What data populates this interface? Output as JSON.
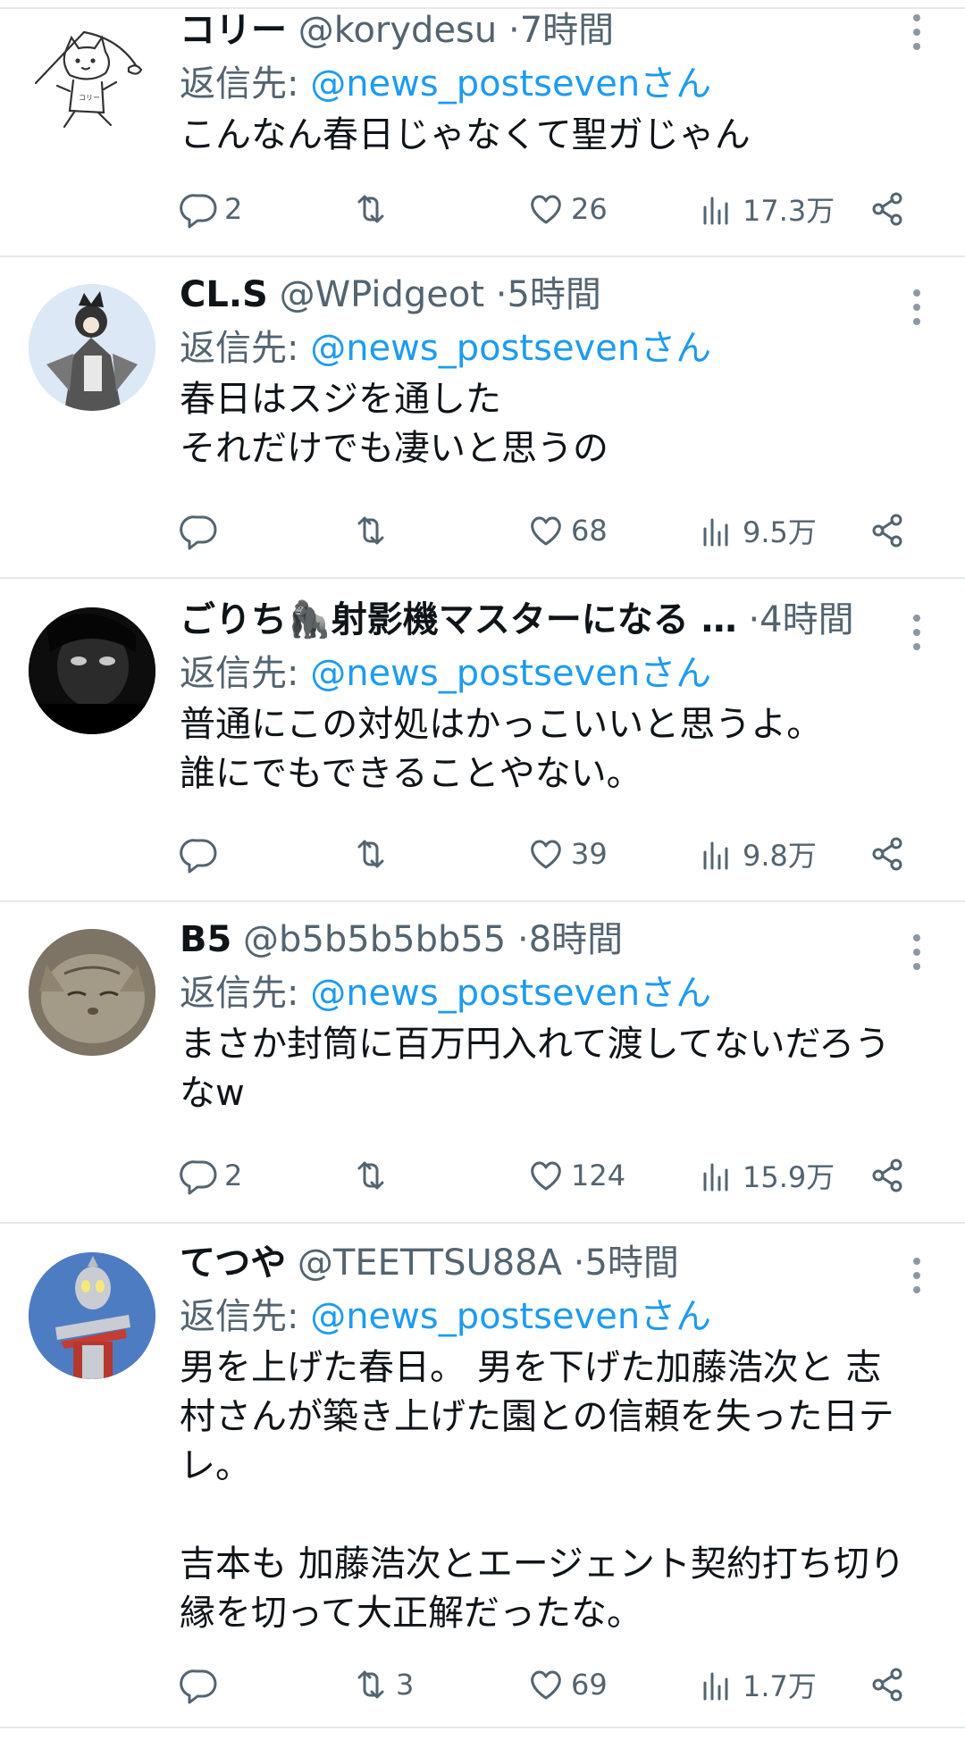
{
  "reply_prefix": "返信先: ",
  "tweets": [
    {
      "name": "コリー",
      "handle": "@korydesu",
      "dot": "·",
      "time": "7時間",
      "reply_to": "@news_postsevenさん",
      "text": "こんなん春日じゃなくて聖ガじゃん",
      "replies": "2",
      "retweets": "",
      "likes": "26",
      "views": "17.3万",
      "avatar_icon": "cat-drawing-icon"
    },
    {
      "name": "CL.S",
      "handle": "@WPidgeot",
      "dot": "·",
      "time": "5時間",
      "reply_to": "@news_postsevenさん",
      "text": "春日はスジを通した\nそれだけでも凄いと思うの",
      "replies": "",
      "retweets": "",
      "likes": "68",
      "views": "9.5万",
      "avatar_icon": "anime-character-icon"
    },
    {
      "name": "ごりち🦍射影機マスターになる …",
      "handle": "",
      "dot": "·",
      "time": "4時間",
      "reply_to": "@news_postsevenさん",
      "text": "普通にこの対処はかっこいいと思うよ。\n誰にでもできることやない。",
      "replies": "",
      "retweets": "",
      "likes": "39",
      "views": "9.8万",
      "avatar_icon": "dark-face-icon"
    },
    {
      "name": "B5",
      "handle": "@b5b5b5bb55",
      "dot": "·",
      "time": "8時間",
      "reply_to": "@news_postsevenさん",
      "text": "まさか封筒に百万円入れて渡してないだろう\nなw",
      "replies": "2",
      "retweets": "",
      "likes": "124",
      "views": "15.9万",
      "avatar_icon": "cat-photo-icon"
    },
    {
      "name": "てつや",
      "handle": "@TEETTSU88A",
      "dot": "·",
      "time": "5時間",
      "reply_to": "@news_postsevenさん",
      "text": "男を上げた春日。 男を下げた加藤浩次と 志\n村さんが築き上げた園との信頼を失った日テ\nレ。\n\n吉本も 加藤浩次とエージェント契約打ち切り\n縁を切って大正解だったな。",
      "replies": "",
      "retweets": "3",
      "likes": "69",
      "views": "1.7万",
      "avatar_icon": "ultraman-icon"
    }
  ]
}
